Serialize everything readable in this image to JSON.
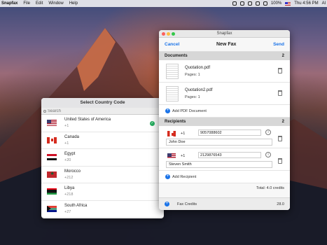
{
  "menubar": {
    "app": "Snapfax",
    "items": [
      "File",
      "Edit",
      "Window",
      "Help"
    ],
    "battery": "100%",
    "clock": "Thu 4:56 PM",
    "user": "Al"
  },
  "country_picker": {
    "title": "Select Country Code",
    "search_placeholder": "Search",
    "countries": [
      {
        "name": "United States of America",
        "code": "+1",
        "flag": "us",
        "selected": true
      },
      {
        "name": "Canada",
        "code": "+1",
        "flag": "ca",
        "selected": false
      },
      {
        "name": "Egypt",
        "code": "+20",
        "flag": "eg",
        "selected": false
      },
      {
        "name": "Morocco",
        "code": "+212",
        "flag": "ma",
        "selected": false
      },
      {
        "name": "Libya",
        "code": "+218",
        "flag": "ly",
        "selected": false
      },
      {
        "name": "South Africa",
        "code": "+27",
        "flag": "za",
        "selected": false
      }
    ]
  },
  "window": {
    "title": "Snapfax",
    "nav": {
      "cancel": "Cancel",
      "title": "New Fax",
      "send": "Send"
    },
    "documents": {
      "header": "Documents",
      "count": "2",
      "items": [
        {
          "name": "Quotation.pdf",
          "pages": "Pages: 1"
        },
        {
          "name": "Quotation2.pdf",
          "pages": "Pages: 1"
        }
      ],
      "add_label": "Add PDF Document"
    },
    "recipients": {
      "header": "Recipients",
      "count": "2",
      "items": [
        {
          "flag": "ca",
          "code": "+1",
          "number": "9057088602",
          "name": "John Doe"
        },
        {
          "flag": "us",
          "code": "+1",
          "number": "2129876543",
          "name": "Steven Smith"
        }
      ],
      "add_label": "Add Recipient"
    },
    "total": "Total: 4.0 credits",
    "credits_label": "Fax Credits",
    "credits_value": "28.0"
  },
  "colors": {
    "accent": "#1a73e8",
    "check": "#27ae60"
  }
}
